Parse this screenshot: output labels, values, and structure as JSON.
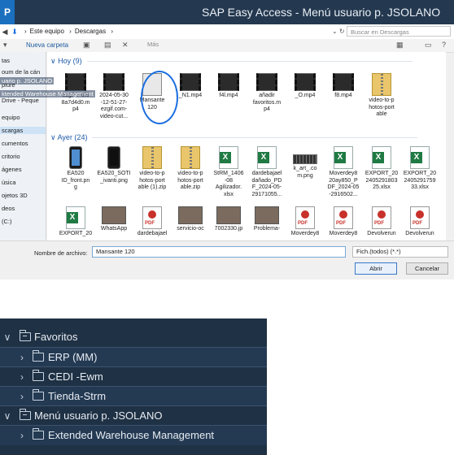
{
  "window": {
    "logo": "P",
    "title": "SAP Easy Access  -  Menú usuario p. JSOLANO"
  },
  "address": {
    "breadcrumb": [
      "Este equipo",
      "Descargas"
    ],
    "search_placeholder": "Buscar en Descargas"
  },
  "toolbar": {
    "new_folder": "Nueva carpeta",
    "more": "Más"
  },
  "nav_pane": {
    "items": [
      "tas",
      "oum de la cán",
      "plure",
      "Drive - Peque",
      "equipo",
      "scargas",
      "cumentos",
      "critorio",
      "ágenes",
      "úsica",
      "ojetos 3D",
      "deos",
      "(C:)"
    ],
    "selected": "scargas"
  },
  "overlay": {
    "line1": "uario p. JSOLANO",
    "line2": "ktended Warehouse Management"
  },
  "groups": {
    "today": "Hoy (9)",
    "yesterday": "Ayer (24)"
  },
  "files_today": [
    {
      "name": "ezgif-7-6f6\n8a7d4d0.m\np4",
      "icon": "video"
    },
    {
      "name": "2024-05-30\n-12-51-27-\nezgif.com-\nvideo-cut...",
      "icon": "video"
    },
    {
      "name": "Mansante\n120",
      "icon": "doc"
    },
    {
      "name": "_N1.mp4",
      "icon": "video"
    },
    {
      "name": "f4l.mp4",
      "icon": "video"
    },
    {
      "name": "añadir\nfavoritos.m\np4",
      "icon": "video"
    },
    {
      "name": "_O.mp4",
      "icon": "video"
    },
    {
      "name": "f8.mp4",
      "icon": "video"
    },
    {
      "name": "video-to-p\nhotos-port\nable",
      "icon": "zip"
    }
  ],
  "files_yesterday": [
    {
      "name": "EA520\nID_front.pn\ng",
      "icon": "phone"
    },
    {
      "name": "EA520_SOTI\n_ivanti.png",
      "icon": "phone2"
    },
    {
      "name": "video-to-p\nhotos-port\nable (1).zip",
      "icon": "zip"
    },
    {
      "name": "video-to-p\nhotos-port\nable.zip",
      "icon": "zip"
    },
    {
      "name": "StRM_1406\n-08\nAgilizador.\nxlsx",
      "icon": "xl"
    },
    {
      "name": "dardebajael\ndañado_PD\nF_2024-05-\n29171055...",
      "icon": "xl"
    },
    {
      "name": "k_art_.co\nm.png",
      "icon": "kb"
    },
    {
      "name": "Moverdey8\n20ay850_P\nDF_2024-05\n-2916502...",
      "icon": "xl"
    },
    {
      "name": "EXPORT_20\n2405291803\n25.xlsx",
      "icon": "xl"
    },
    {
      "name": "EXPORT_20\n2405291759\n33.xlsx",
      "icon": "xl"
    }
  ],
  "files_row3": [
    {
      "name": "EXPORT_20",
      "icon": "xl"
    },
    {
      "name": "WhatsApp",
      "icon": "pic"
    },
    {
      "name": "dardebajael",
      "icon": "pdf"
    },
    {
      "name": "servicio-oc",
      "icon": "pic"
    },
    {
      "name": "7002330.jp",
      "icon": "pic"
    },
    {
      "name": "Problema-",
      "icon": "pic"
    },
    {
      "name": "Moverdey8",
      "icon": "pdf"
    },
    {
      "name": "Moverdey8",
      "icon": "pdf"
    },
    {
      "name": "Devolverun",
      "icon": "pdf"
    },
    {
      "name": "Devolverun",
      "icon": "pdf"
    }
  ],
  "footer": {
    "filename_label": "Nombre de archivo:",
    "filename_value": "Mansante 120",
    "filetype": "Fich.(todos) (*.*)",
    "open": "Abrir",
    "cancel": "Cancelar"
  },
  "tree": {
    "favorites": "Favoritos",
    "erp": "ERP (MM)",
    "cedi": "CEDI -Ewm",
    "tienda": "Tienda-Strm",
    "user_menu": "Menú usuario p. JSOLANO",
    "ewm": "Extended Warehouse Management"
  }
}
